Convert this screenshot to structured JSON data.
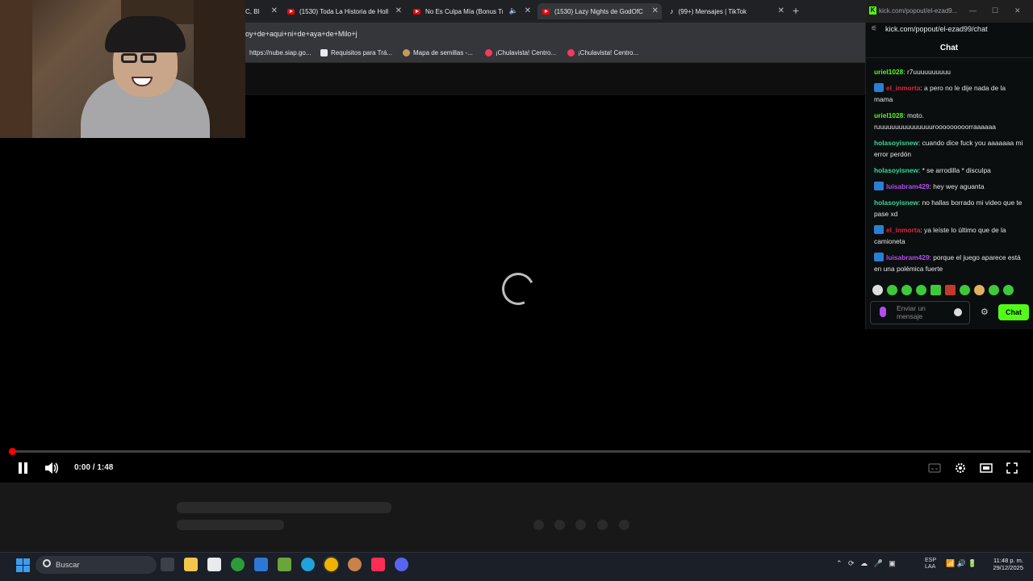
{
  "browser": {
    "tabs": [
      {
        "label": "C, Bl",
        "favicon": "generic-icon"
      },
      {
        "label": "(1530) Toda La Historia de Holl",
        "favicon": "youtube-icon"
      },
      {
        "label": "No Es Culpa Mía (Bonus Tr",
        "favicon": "youtube-icon"
      },
      {
        "label": "(1530) Lazy Nights de GodOfC",
        "favicon": "youtube-icon"
      },
      {
        "label": "(99+) Mensajes | TikTok",
        "favicon": "tiktok-icon"
      }
    ],
    "url": "oy+de+aqui+ni+de+aya+de+Milo+j",
    "bookmarks": [
      {
        "label": "https://nube.siap.go...",
        "icon": "globe-icon"
      },
      {
        "label": "Requisitos para Trá...",
        "icon": "doc-icon"
      },
      {
        "label": "Mapa de semillas -...",
        "icon": "map-icon"
      },
      {
        "label": "¡Chulavista! Centro...",
        "icon": "airbnb-icon"
      },
      {
        "label": "¡Chulavista! Centro...",
        "icon": "airbnb-icon"
      }
    ]
  },
  "player": {
    "time": "0:00 / 1:48",
    "progress": 0.0
  },
  "kick": {
    "window_title": "kick.com/popout/el-ezad9...",
    "url": "kick.com/popout/el-ezad99/chat",
    "header": "Chat",
    "messages": [
      {
        "user": "uriel1028",
        "text": ": r7uuuuuuuuuu",
        "color": "#53fc18",
        "badge": false
      },
      {
        "user": "el_inmorta",
        "text": ": a pero no le dije nada de la mama",
        "color": "#e0263d",
        "badge": true
      },
      {
        "user": "uriel1028",
        "text": ": moto. ruuuuuuuuuuuuuuurooooooooorraaaaaa",
        "color": "#53fc18",
        "badge": false
      },
      {
        "user": "holasoyisnew",
        "text": ": cuando dice fuck you aaaaaaa mi error perdón",
        "color": "#3cd69b",
        "badge": false
      },
      {
        "user": "holasoyisnew",
        "text": ": * se arrodilla * disculpa",
        "color": "#3cd69b",
        "badge": false
      },
      {
        "user": "luisabram429",
        "text": ": hey wey aguanta",
        "color": "#b44df0",
        "badge": true
      },
      {
        "user": "holasoyisnew",
        "text": ": no hallas borrado mi video que te pase xd",
        "color": "#3cd69b",
        "badge": false
      },
      {
        "user": "el_inmorta",
        "text": ": ya leíste lo último que de la camioneta",
        "color": "#e0263d",
        "badge": true
      },
      {
        "user": "luisabram429",
        "text": ": porque el juego aparece está en una polémica fuerte",
        "color": "#b44df0",
        "badge": true
      }
    ],
    "input_placeholder": "Enviar un mensaje",
    "send_label": "Chat",
    "accent": "#53fc18"
  },
  "taskbar": {
    "search_placeholder": "Buscar",
    "lang_line1": "ESP",
    "lang_line2": "LAA",
    "time": "11:48 p. m.",
    "date": "29/12/2025"
  }
}
